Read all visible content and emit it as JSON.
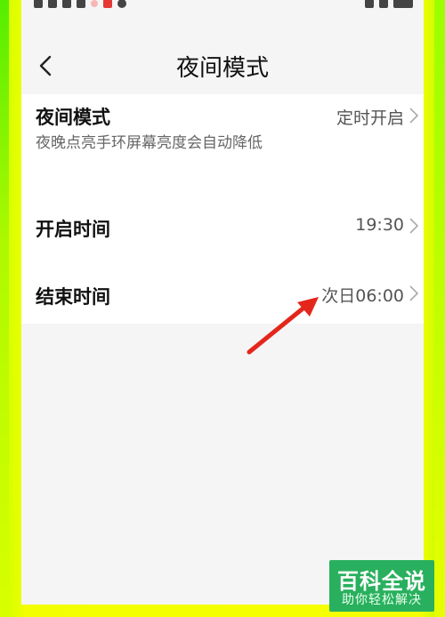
{
  "header": {
    "title": "夜间模式"
  },
  "settings": [
    {
      "title": "夜间模式",
      "description": "夜晚点亮手环屏幕亮度会自动降低",
      "value": "定时开启"
    },
    {
      "title": "开启时间",
      "description": "",
      "value": "19:30"
    },
    {
      "title": "结束时间",
      "description": "",
      "value": "次日06:00"
    }
  ],
  "watermark": {
    "main": "百科全说",
    "sub": "助你轻松解决"
  },
  "colors": {
    "frame": "#f3ff00",
    "background": "#f5f5f5",
    "arrow": "#e4261b",
    "watermark": "#29b05e"
  },
  "icons": {
    "back": "chevron-left-icon",
    "row_chevron": "chevron-right-icon",
    "annotation": "red-arrow"
  }
}
